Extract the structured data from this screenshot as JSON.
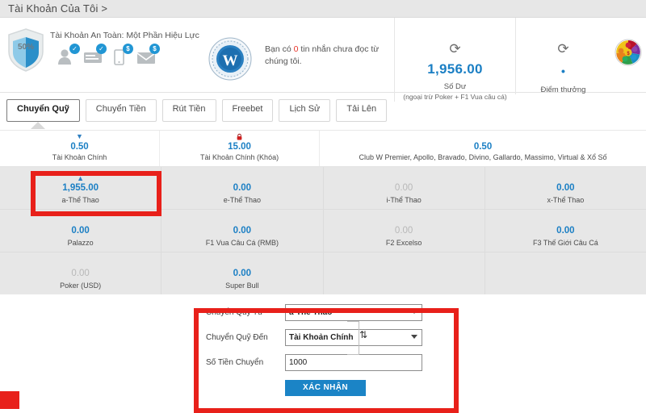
{
  "page": {
    "title": "Tài Khoản Của Tôi >"
  },
  "security": {
    "shield_percent": "50%",
    "title": "Tài Khoản An Toàn: Một Phần Hiệu Lực",
    "icons": [
      {
        "name": "person-icon",
        "badge": "✓"
      },
      {
        "name": "card-icon",
        "badge": "✓"
      },
      {
        "name": "phone-icon",
        "badge": "$"
      },
      {
        "name": "envelope-icon",
        "badge": "$"
      }
    ]
  },
  "message": {
    "before": "Bạn có ",
    "count": "0",
    "after": " tin nhắn chưa đọc từ chúng tôi."
  },
  "balance": {
    "refresh_icon": "⟳",
    "value": "1,956.00",
    "label": "Số Dư",
    "sublabel": "(ngoại trừ Poker + F1 Vua câu cá)"
  },
  "points": {
    "refresh_icon": "⟳",
    "value": "•",
    "label": "Điểm thưởng"
  },
  "tabs": [
    {
      "label": "Chuyển Quỹ",
      "active": true
    },
    {
      "label": "Chuyển Tiền",
      "active": false
    },
    {
      "label": "Rút Tiền",
      "active": false
    },
    {
      "label": "Freebet",
      "active": false
    },
    {
      "label": "Lịch Sử",
      "active": false
    },
    {
      "label": "Tải Lên",
      "active": false
    }
  ],
  "summary": [
    {
      "value": "0.50",
      "name": "Tài Khoản Chính",
      "icon": "arrow-down"
    },
    {
      "value": "15.00",
      "name": "Tài Khoản Chính (Khóa)",
      "icon": "lock"
    },
    {
      "value": "0.50",
      "name": "Club W Premier, Apollo, Bravado, Divino, Gallardo, Massimo, Virtual & Xổ Số",
      "icon": "none"
    }
  ],
  "wallets": [
    [
      {
        "value": "1,955.00",
        "name": "a-Thể Thao",
        "icon": "arrow-up",
        "highlighted": true
      },
      {
        "value": "0.00",
        "name": "e-Thể Thao",
        "icon": "none",
        "highlighted": false
      },
      {
        "value": "0.00",
        "name": "i-Thể Thao",
        "icon": "none",
        "highlighted": false,
        "faint": true
      },
      {
        "value": "0.00",
        "name": "x-Thể Thao",
        "icon": "none",
        "highlighted": false
      }
    ],
    [
      {
        "value": "0.00",
        "name": "Palazzo",
        "icon": "none",
        "highlighted": false
      },
      {
        "value": "0.00",
        "name": "F1 Vua Câu Cá (RMB)",
        "icon": "none",
        "highlighted": false
      },
      {
        "value": "0.00",
        "name": "F2 Excelso",
        "icon": "none",
        "highlighted": false,
        "faint": true
      },
      {
        "value": "0.00",
        "name": "F3 Thế Giới Câu Cá",
        "icon": "none",
        "highlighted": false
      }
    ],
    [
      {
        "value": "0.00",
        "name": "Poker (USD)",
        "icon": "none",
        "highlighted": false,
        "faint": true
      },
      {
        "value": "0.00",
        "name": "Super Bull",
        "icon": "none",
        "highlighted": false
      },
      {
        "value": "",
        "name": "",
        "icon": "none",
        "highlighted": false
      },
      {
        "value": "",
        "name": "",
        "icon": "none",
        "highlighted": false
      }
    ]
  ],
  "form": {
    "from_label": "Chuyển Quỹ Từ",
    "from_value": "a-Thể Thao",
    "to_label": "Chuyển Quỹ Đến",
    "to_value": "Tài Khoản Chính",
    "amount_label": "Số Tiền Chuyển",
    "amount_value": "1000",
    "swap_icon": "⇅",
    "confirm_label": "XÁC NHẬN"
  },
  "colors": {
    "accent_blue": "#1b7fc4",
    "button_blue": "#1b84c6",
    "annotation_red": "#e8201a",
    "alert_red": "#e8342a",
    "panel_gray": "#e7e7e7"
  }
}
